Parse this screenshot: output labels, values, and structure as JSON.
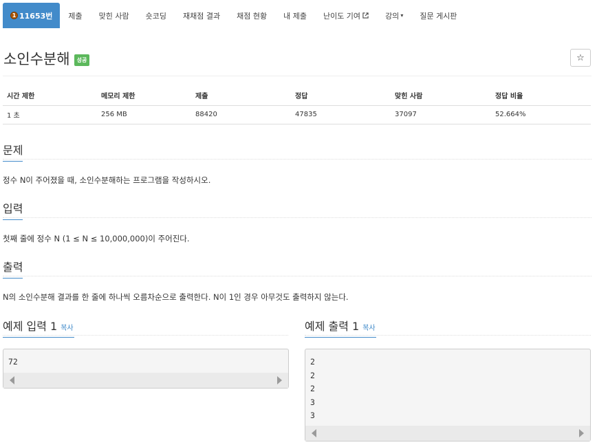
{
  "nav": {
    "tier_badge": "1",
    "items": [
      {
        "label": "11653번"
      },
      {
        "label": "제출"
      },
      {
        "label": "맞힌 사람"
      },
      {
        "label": "숏코딩"
      },
      {
        "label": "재채점 결과"
      },
      {
        "label": "채점 현황"
      },
      {
        "label": "내 제출"
      },
      {
        "label": "난이도 기여"
      },
      {
        "label": "강의"
      },
      {
        "label": "질문 게시판"
      }
    ]
  },
  "problem": {
    "title": "소인수분해",
    "status_label": "성공",
    "star_icon": "☆"
  },
  "info_table": {
    "headers": [
      "시간 제한",
      "메모리 제한",
      "제출",
      "정답",
      "맞힌 사람",
      "정답 비율"
    ],
    "row": [
      "1 초",
      "256 MB",
      "88420",
      "47835",
      "37097",
      "52.664%"
    ]
  },
  "sections": {
    "description": {
      "heading": "문제",
      "text": "정수 N이 주어졌을 때, 소인수분해하는 프로그램을 작성하시오."
    },
    "input": {
      "heading": "입력",
      "text": "첫째 줄에 정수 N (1 ≤ N ≤ 10,000,000)이 주어진다."
    },
    "output": {
      "heading": "출력",
      "text": "N의 소인수분해 결과를 한 줄에 하나씩 오름차순으로 출력한다. N이 1인 경우 아무것도 출력하지 않는다."
    }
  },
  "samples": {
    "copy_label": "복사",
    "input": {
      "heading": "예제 입력 1",
      "content": "72"
    },
    "output": {
      "heading": "예제 출력 1",
      "content": "2\n2\n2\n3\n3"
    }
  }
}
